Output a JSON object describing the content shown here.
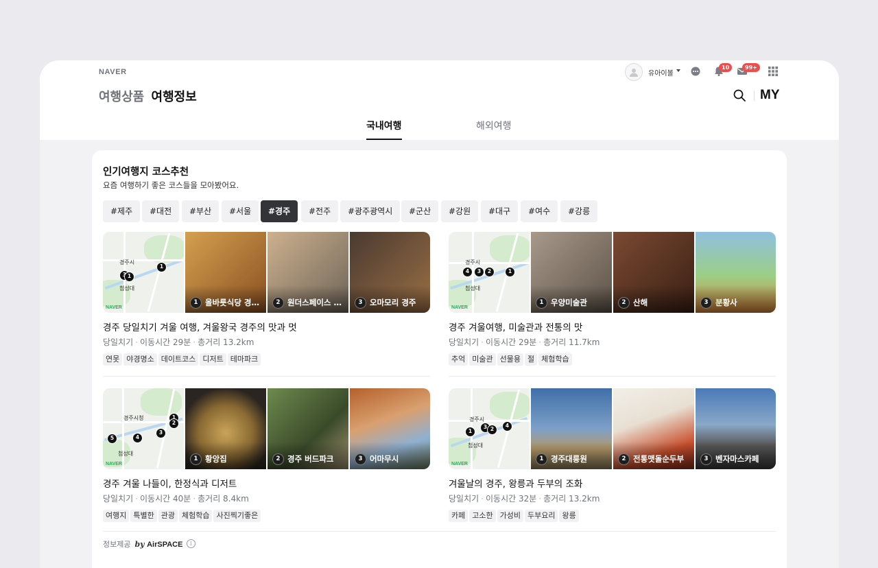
{
  "header": {
    "logo": "NAVER",
    "service_sub": "여행상품",
    "service_main": "여행정보",
    "username": "유아이볼",
    "notif_count": "10",
    "mail_count": "99+",
    "my_label": "MY"
  },
  "tabs": [
    {
      "label": "국내여행",
      "active": true
    },
    {
      "label": "해외여행",
      "active": false
    }
  ],
  "section": {
    "title": "인기여행지 코스추천",
    "desc": "요즘 여행하기 좋은 코스들을 모아봤어요."
  },
  "chips": [
    "#제주",
    "#대전",
    "#부산",
    "#서울",
    "#경주",
    "#전주",
    "#광주광역시",
    "#군산",
    "#강원",
    "#대구",
    "#여수",
    "#강릉"
  ],
  "selected_chip": "#경주",
  "courses": [
    {
      "title": "경주 당일치기 겨울 여행, 겨울왕국 경주의 맛과 멋",
      "type": "당일치기",
      "time": "이동시간 29분",
      "distance": "총거리 13.2km",
      "tags": [
        "연못",
        "야경명소",
        "데이트코스",
        "디저트",
        "테마파크"
      ],
      "map": {
        "city": "경주시",
        "sub": "첨성대",
        "brand": "NAVER",
        "pins": [
          "3",
          "1",
          "1"
        ]
      },
      "stops": [
        {
          "num": "1",
          "name": "올바릇식당 경주점",
          "color": "#c78a45"
        },
        {
          "num": "2",
          "name": "원더스페이스 경주",
          "color": "#b39a78"
        },
        {
          "num": "3",
          "name": "오마모리 경주",
          "color": "#5a4536"
        }
      ]
    },
    {
      "title": "경주 겨울여행, 미술관과 전통의 맛",
      "type": "당일치기",
      "time": "이동시간 29분",
      "distance": "총거리 11.7km",
      "tags": [
        "추억",
        "미술관",
        "선물용",
        "절",
        "체험학습"
      ],
      "map": {
        "city": "경주시",
        "sub": "첨성대",
        "brand": "NAVER",
        "pins": [
          "4",
          "3",
          "2",
          "1"
        ]
      },
      "stops": [
        {
          "num": "1",
          "name": "우양미술관",
          "color": "#8a7a68"
        },
        {
          "num": "2",
          "name": "산해",
          "color": "#6b3f2a"
        },
        {
          "num": "3",
          "name": "분황사",
          "color": "#7da56a"
        }
      ]
    },
    {
      "title": "경주 겨울 나들이, 한정식과 디저트",
      "type": "당일치기",
      "time": "이동시간 40분",
      "distance": "총거리 8.4km",
      "tags": [
        "여행지",
        "특별한",
        "관광",
        "체험학습",
        "사진찍기좋은"
      ],
      "map": {
        "city": "경주시청",
        "sub": "첨성대",
        "brand": "NAVER",
        "pins": [
          "1",
          "2",
          "3",
          "4",
          "5"
        ]
      },
      "stops": [
        {
          "num": "1",
          "name": "황앙집",
          "color": "#a9864a"
        },
        {
          "num": "2",
          "name": "경주 버드파크",
          "color": "#5e7b46"
        },
        {
          "num": "3",
          "name": "어마무시",
          "color": "#b98a5e"
        }
      ]
    },
    {
      "title": "겨울날의 경주, 왕릉과 두부의 조화",
      "type": "당일치기",
      "time": "이동시간 32분",
      "distance": "총거리 13.2km",
      "tags": [
        "카페",
        "고소한",
        "가성비",
        "두부요리",
        "왕릉"
      ],
      "map": {
        "city": "경주시",
        "sub": "첨성대",
        "brand": "NAVER",
        "pins": [
          "1",
          "3",
          "2",
          "4"
        ]
      },
      "stops": [
        {
          "num": "1",
          "name": "경주대릉원",
          "color": "#6f8fb8"
        },
        {
          "num": "2",
          "name": "전통맷돌순두부",
          "color": "#d8c9b8"
        },
        {
          "num": "3",
          "name": "벤자마스카페",
          "color": "#4a5a6e"
        }
      ]
    }
  ],
  "footer": {
    "provider_label": "정보제공",
    "by": "by",
    "brand": "AirSPACE",
    "info": "i"
  },
  "colors": {
    "accent_dark": "#333437",
    "badge": "#f04c4c",
    "naver_green": "#1fb356"
  }
}
